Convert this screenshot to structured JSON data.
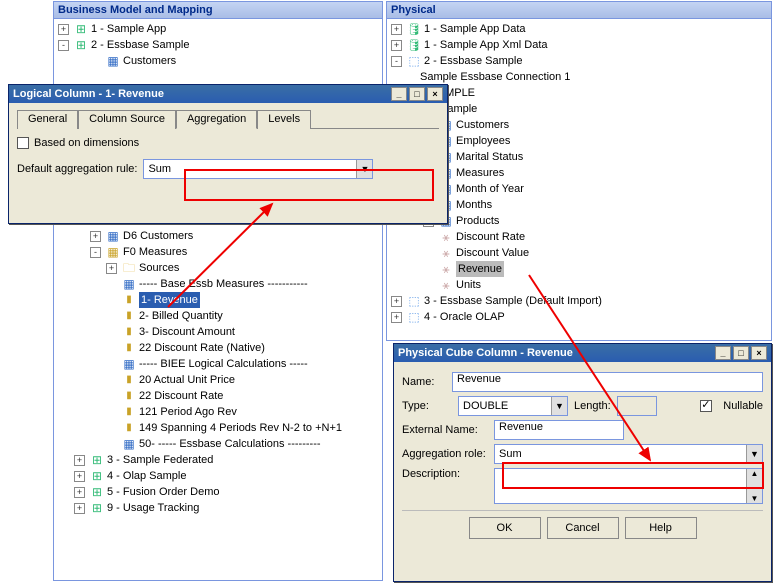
{
  "left_panel": {
    "title": "Business Model and Mapping",
    "tree_top": [
      {
        "exp": "+",
        "icon": "icon-db",
        "glyph": "⊞",
        "label": "1 - Sample App"
      },
      {
        "exp": "-",
        "icon": "icon-db",
        "glyph": "⊞",
        "label": "2 - Essbase Sample"
      },
      {
        "exp": "",
        "indent": 2,
        "icon": "icon-dim",
        "glyph": "▦",
        "label": "Customers"
      }
    ],
    "tree_mid": [
      {
        "exp": "+",
        "indent": 2,
        "icon": "icon-dim",
        "glyph": "▦",
        "label": "D6 Customers"
      },
      {
        "exp": "-",
        "indent": 2,
        "icon": "icon-fact",
        "glyph": "▦",
        "label": "F0 Measures"
      },
      {
        "exp": "+",
        "indent": 3,
        "icon": "icon-folder",
        "glyph": "🗀",
        "label": "Sources"
      },
      {
        "exp": "",
        "indent": 3,
        "icon": "icon-dim",
        "glyph": "▦",
        "label": "----- Base Essb Measures -----------"
      },
      {
        "exp": "",
        "indent": 3,
        "icon": "icon-col",
        "glyph": "▮",
        "label": "1- Revenue",
        "selected": true
      },
      {
        "exp": "",
        "indent": 3,
        "icon": "icon-col",
        "glyph": "▮",
        "label": "2- Billed Quantity"
      },
      {
        "exp": "",
        "indent": 3,
        "icon": "icon-col",
        "glyph": "▮",
        "label": "3- Discount Amount"
      },
      {
        "exp": "",
        "indent": 3,
        "icon": "icon-col",
        "glyph": "▮",
        "label": "22  Discount Rate (Native)"
      },
      {
        "exp": "",
        "indent": 3,
        "icon": "icon-dim",
        "glyph": "▦",
        "label": "----- BIEE Logical Calculations -----"
      },
      {
        "exp": "",
        "indent": 3,
        "icon": "icon-col",
        "glyph": "▮",
        "label": "20  Actual Unit Price"
      },
      {
        "exp": "",
        "indent": 3,
        "icon": "icon-col",
        "glyph": "▮",
        "label": "22  Discount Rate"
      },
      {
        "exp": "",
        "indent": 3,
        "icon": "icon-col",
        "glyph": "▮",
        "label": "121  Period Ago Rev"
      },
      {
        "exp": "",
        "indent": 3,
        "icon": "icon-col",
        "glyph": "▮",
        "label": "149  Spanning 4 Periods Rev N-2 to +N+1"
      },
      {
        "exp": "",
        "indent": 3,
        "icon": "icon-dim",
        "glyph": "▦",
        "label": "50- ----- Essbase Calculations ---------"
      },
      {
        "exp": "+",
        "indent": 1,
        "icon": "icon-db",
        "glyph": "⊞",
        "label": "3 - Sample Federated"
      },
      {
        "exp": "+",
        "indent": 1,
        "icon": "icon-db",
        "glyph": "⊞",
        "label": "4 - Olap Sample"
      },
      {
        "exp": "+",
        "indent": 1,
        "icon": "icon-db",
        "glyph": "⊞",
        "label": "5 - Fusion Order Demo"
      },
      {
        "exp": "+",
        "indent": 1,
        "icon": "icon-db",
        "glyph": "⊞",
        "label": "9 - Usage Tracking"
      }
    ]
  },
  "right_panel": {
    "title": "Physical",
    "tree": [
      {
        "exp": "+",
        "indent": 0,
        "icon": "icon-db",
        "glyph": "🛢",
        "label": "1 - Sample App Data"
      },
      {
        "exp": "+",
        "indent": 0,
        "icon": "icon-db",
        "glyph": "🛢",
        "label": "1 - Sample App Xml Data"
      },
      {
        "exp": "-",
        "indent": 0,
        "icon": "icon-cubeblue",
        "glyph": "⬚",
        "label": "2 - Essbase Sample"
      },
      {
        "exp": "",
        "indent": 1,
        "icon": "",
        "glyph": "",
        "label": "Sample Essbase Connection 1"
      },
      {
        "exp": "",
        "indent": 1,
        "icon": "",
        "glyph": "",
        "label": "BISAMPLE"
      },
      {
        "exp": "",
        "indent": 1,
        "icon": "icon-cubeblue",
        "glyph": "⬚",
        "label": "Sample"
      },
      {
        "exp": "+",
        "indent": 2,
        "icon": "icon-dim",
        "glyph": "▦",
        "label": "Customers"
      },
      {
        "exp": "+",
        "indent": 2,
        "icon": "icon-dim",
        "glyph": "▦",
        "label": "Employees"
      },
      {
        "exp": "+",
        "indent": 2,
        "icon": "icon-dim",
        "glyph": "▦",
        "label": "Marital Status"
      },
      {
        "exp": "+",
        "indent": 2,
        "icon": "icon-dim",
        "glyph": "▦",
        "label": "Measures"
      },
      {
        "exp": "+",
        "indent": 2,
        "icon": "icon-dim",
        "glyph": "▦",
        "label": "Month of Year"
      },
      {
        "exp": "+",
        "indent": 2,
        "icon": "icon-dim",
        "glyph": "▦",
        "label": "Months"
      },
      {
        "exp": "+",
        "indent": 2,
        "icon": "icon-dim",
        "glyph": "▦",
        "label": "Products"
      },
      {
        "exp": "",
        "indent": 2,
        "icon": "icon-measure",
        "glyph": "⚹",
        "label": "Discount Rate"
      },
      {
        "exp": "",
        "indent": 2,
        "icon": "icon-measure",
        "glyph": "⚹",
        "label": "Discount Value"
      },
      {
        "exp": "",
        "indent": 2,
        "icon": "icon-measure",
        "glyph": "⚹",
        "label": "Revenue",
        "grey": true
      },
      {
        "exp": "",
        "indent": 2,
        "icon": "icon-measure",
        "glyph": "⚹",
        "label": "Units"
      },
      {
        "exp": "+",
        "indent": 0,
        "icon": "icon-cubeblue",
        "glyph": "⬚",
        "label": "3 - Essbase Sample (Default Import)"
      },
      {
        "exp": "+",
        "indent": 0,
        "icon": "icon-cubeblue",
        "glyph": "⬚",
        "label": "4 - Oracle OLAP"
      }
    ]
  },
  "logical_dialog": {
    "title": "Logical Column - 1- Revenue",
    "tabs": [
      "General",
      "Column Source",
      "Aggregation",
      "Levels"
    ],
    "active_tab": 2,
    "checkbox_label": "Based on dimensions",
    "default_rule_label": "Default aggregation rule:",
    "default_rule_value": "Sum"
  },
  "physical_dialog": {
    "title": "Physical Cube Column - Revenue",
    "name_label": "Name:",
    "name_value": "Revenue",
    "type_label": "Type:",
    "type_value": "DOUBLE",
    "length_label": "Length:",
    "length_value": "",
    "nullable_label": "Nullable",
    "nullable_checked": true,
    "extname_label": "External Name:",
    "extname_value": "Revenue",
    "aggrole_label": "Aggregation role:",
    "aggrole_value": "Sum",
    "desc_label": "Description:",
    "buttons": {
      "ok": "OK",
      "cancel": "Cancel",
      "help": "Help"
    }
  }
}
